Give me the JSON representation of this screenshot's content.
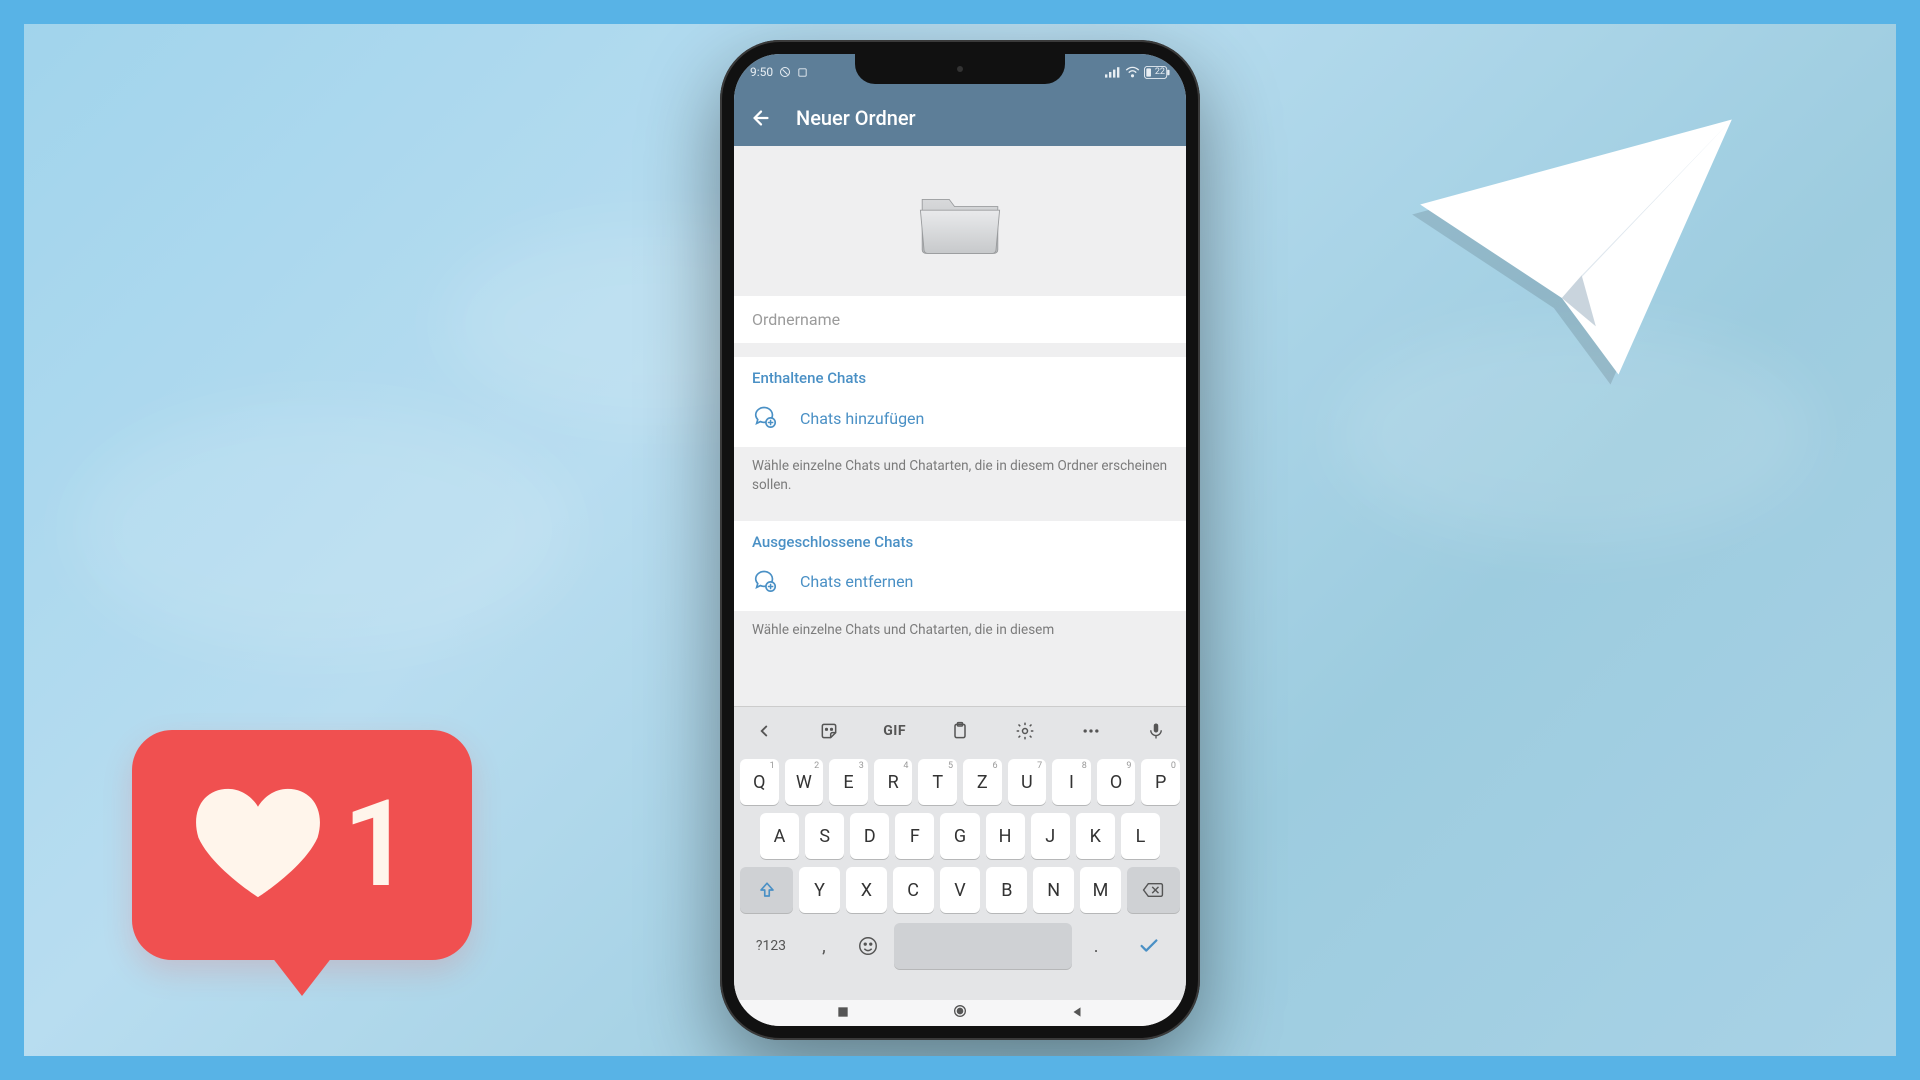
{
  "status": {
    "time": "9:50",
    "battery": "22"
  },
  "appbar": {
    "title": "Neuer Ordner"
  },
  "input": {
    "placeholder": "Ordnername",
    "value": ""
  },
  "sections": {
    "included": {
      "header": "Enthaltene Chats",
      "action": "Chats hinzufügen",
      "desc": "Wähle einzelne Chats und Chatarten, die in diesem Ordner erscheinen sollen."
    },
    "excluded": {
      "header": "Ausgeschlossene Chats",
      "action": "Chats entfernen",
      "desc": "Wähle einzelne Chats und Chatarten, die in diesem"
    }
  },
  "keyboard": {
    "toolbar_gif": "GIF",
    "row1": [
      "Q",
      "W",
      "E",
      "R",
      "T",
      "Z",
      "U",
      "I",
      "O",
      "P"
    ],
    "row1_super": [
      "1",
      "2",
      "3",
      "4",
      "5",
      "6",
      "7",
      "8",
      "9",
      "0"
    ],
    "row2": [
      "A",
      "S",
      "D",
      "F",
      "G",
      "H",
      "J",
      "K",
      "L"
    ],
    "row3": [
      "Y",
      "X",
      "C",
      "V",
      "B",
      "N",
      "M"
    ],
    "sym": "?123",
    "comma": ",",
    "dot": "."
  },
  "like": {
    "count": "1"
  },
  "colors": {
    "accent": "#4a90c5",
    "header": "#5d7e98",
    "like": "#f05050"
  }
}
